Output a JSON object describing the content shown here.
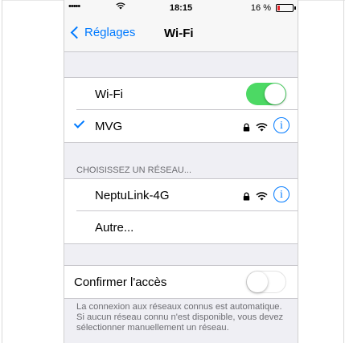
{
  "status_bar": {
    "signal": "•••••",
    "time": "18:15",
    "battery_text": "16 %",
    "battery_level": 0.16
  },
  "nav": {
    "back_label": "Réglages",
    "title": "Wi-Fi"
  },
  "wifi_row": {
    "label": "Wi-Fi",
    "toggle_on": true
  },
  "connected": {
    "name": "MVG",
    "secured": true
  },
  "section_header": "CHOISISSEZ UN RÉSEAU...",
  "networks": [
    {
      "name": "NeptuLink-4G",
      "secured": true
    }
  ],
  "other_label": "Autre...",
  "confirm_row": {
    "label": "Confirmer l'accès",
    "toggle_on": false
  },
  "footer": "La connexion aux réseaux connus est automatique. Si aucun réseau connu n'est disponible, vous devez sélectionner manuellement un réseau.",
  "colors": {
    "accent": "#007aff",
    "toggle_on": "#4cd964",
    "battery_low": "#e8262b"
  }
}
